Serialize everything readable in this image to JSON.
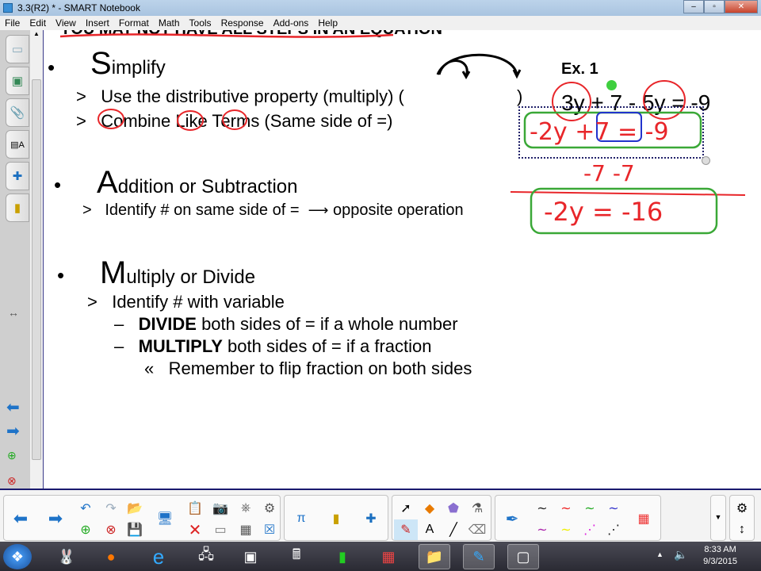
{
  "window": {
    "title": "3.3(R2) * - SMART Notebook"
  },
  "menu": [
    "File",
    "Edit",
    "View",
    "Insert",
    "Format",
    "Math",
    "Tools",
    "Response",
    "Add-ons",
    "Help"
  ],
  "slide": {
    "header_partial": "YOU MAY NOT HAVE ALL STEPS IN AN EQUATION",
    "s1": {
      "initial": "S",
      "rest": "implify",
      "l1": "Use the distributive property (multiply)  (",
      "l1b": ")",
      "l2": "Combine Like Terms  (Same side of =)"
    },
    "s2": {
      "initial": "A",
      "rest": "ddition or Subtraction",
      "l1": "Identify # on same side of =",
      "l1b": "opposite operation"
    },
    "s3": {
      "initial": "M",
      "rest": "ultiply or Divide",
      "l1": "Identify # with variable",
      "d1b": "DIVIDE",
      "d1": " both sides of = if a whole number",
      "d2b": "MULTIPLY",
      "d2": " both sides of = if a fraction",
      "sub": "Remember to flip fraction on both sides"
    },
    "bullet": "•",
    "gt": ">",
    "dash": "–",
    "guillemet": "«",
    "example": {
      "label": "Ex. 1",
      "equation": "3y + 7 - 5y = -9",
      "ink1": "-2y +7 = -9",
      "ink2": "-7   -7",
      "ink3": "-2y = -16"
    }
  },
  "colors": {
    "ink_red": "#e8262a",
    "ink_green": "#3aa837",
    "ink_blue": "#2233cc"
  },
  "clock": {
    "time": "8:33 AM",
    "date": "9/3/2015"
  }
}
